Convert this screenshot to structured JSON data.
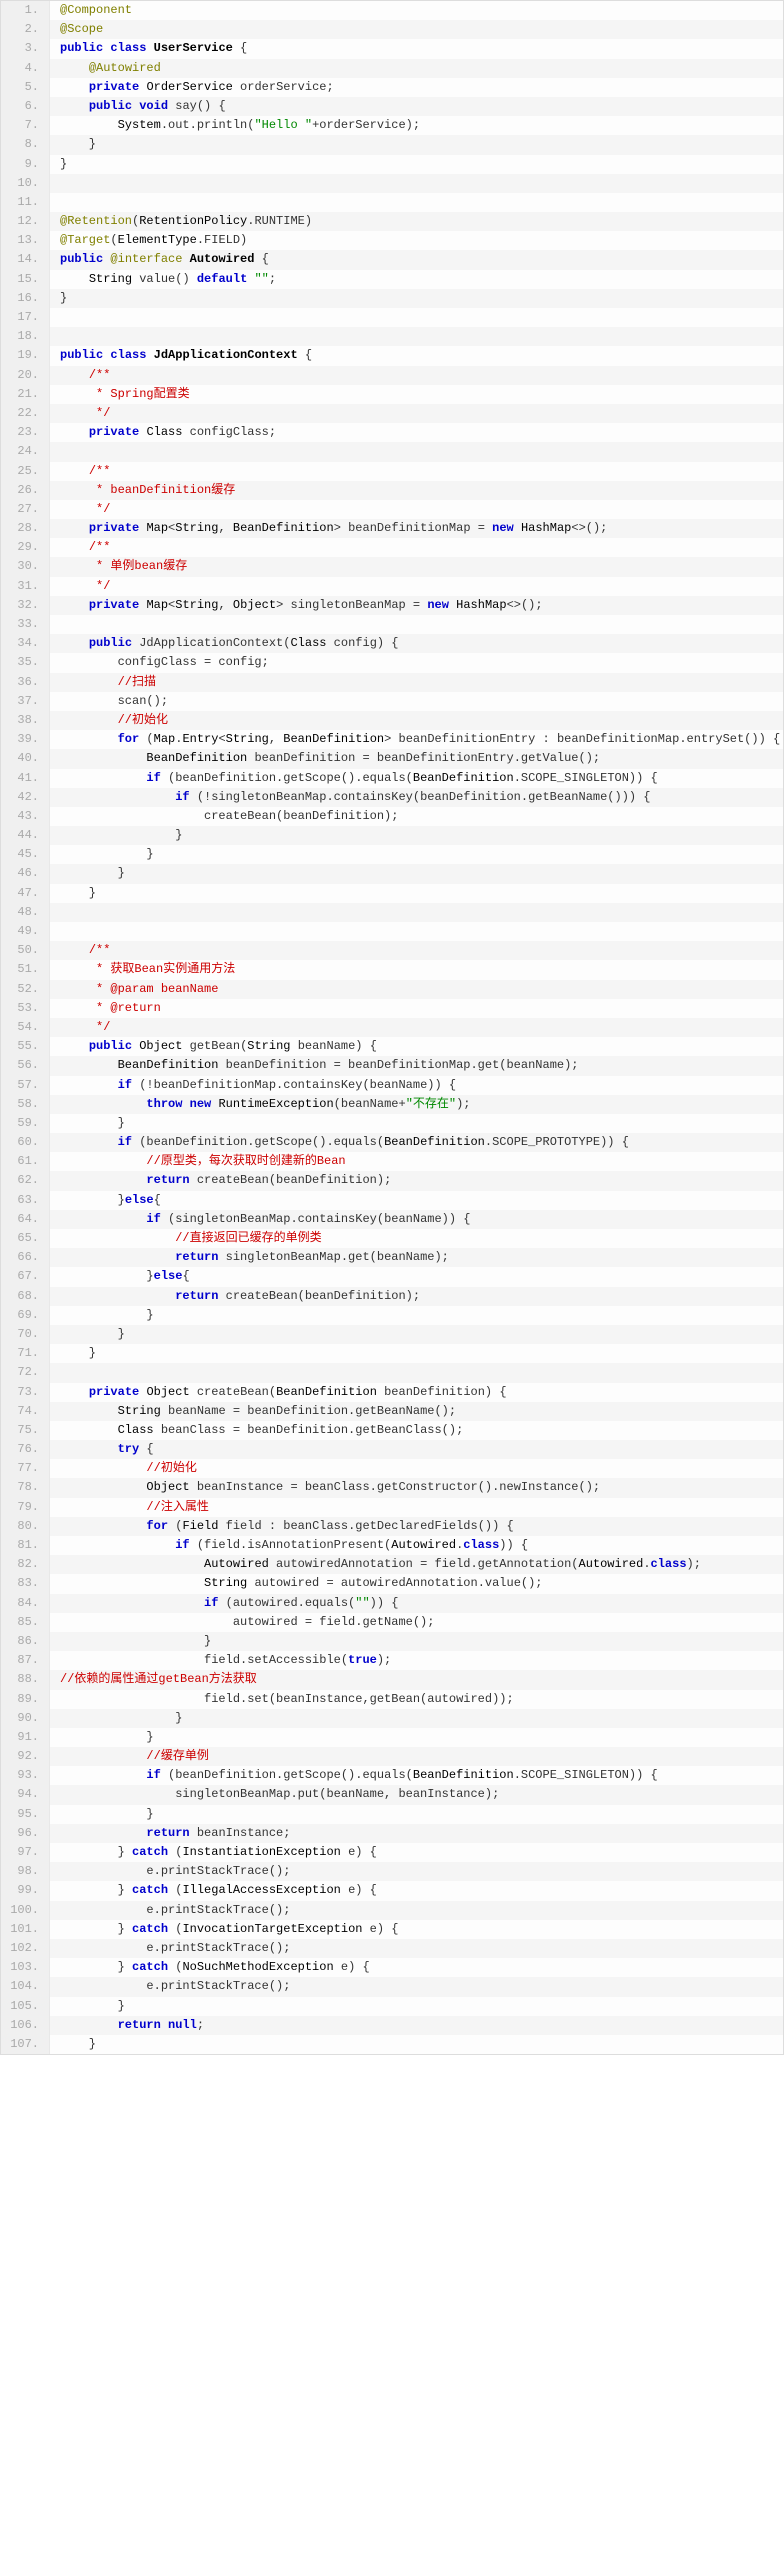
{
  "lines": [
    {
      "n": 1,
      "h": "<span class='an'>@Component</span>"
    },
    {
      "n": 2,
      "h": "<span class='an'>@Scope</span>"
    },
    {
      "n": 3,
      "h": "<span class='kw'>public</span> <span class='kw'>class</span> <span class='cl'>UserService</span> {"
    },
    {
      "n": 4,
      "h": "    <span class='an'>@Autowired</span>"
    },
    {
      "n": 5,
      "h": "    <span class='kw'>private</span> <span class='ty'>OrderService</span> orderService;"
    },
    {
      "n": 6,
      "h": "    <span class='kw'>public</span> <span class='kw'>void</span> <span class='fn'>say</span>() {"
    },
    {
      "n": 7,
      "h": "        <span class='ty'>System</span>.out.println(<span class='st'>\"Hello \"</span>+orderService);"
    },
    {
      "n": 8,
      "h": "    }"
    },
    {
      "n": 9,
      "h": "}"
    },
    {
      "n": 10,
      "h": ""
    },
    {
      "n": 11,
      "h": ""
    },
    {
      "n": 12,
      "h": "<span class='an'>@Retention</span>(<span class='ty'>RetentionPolicy</span>.RUNTIME)"
    },
    {
      "n": 13,
      "h": "<span class='an'>@Target</span>(<span class='ty'>ElementType</span>.FIELD)"
    },
    {
      "n": 14,
      "h": "<span class='kw'>public</span> <span class='an'>@interface</span> <span class='cl'>Autowired</span> {"
    },
    {
      "n": 15,
      "h": "    <span class='ty'>String</span> <span class='fn'>value</span>() <span class='kw'>default</span> <span class='st'>\"\"</span>;"
    },
    {
      "n": 16,
      "h": "}"
    },
    {
      "n": 17,
      "h": ""
    },
    {
      "n": 18,
      "h": ""
    },
    {
      "n": 19,
      "h": "<span class='kw'>public</span> <span class='kw'>class</span> <span class='cl'>JdApplicationContext</span> {"
    },
    {
      "n": 20,
      "h": "    <span class='cm'>/**</span>"
    },
    {
      "n": 21,
      "h": "<span class='cm'>     * Spring配置类</span>"
    },
    {
      "n": 22,
      "h": "<span class='cm'>     */</span>"
    },
    {
      "n": 23,
      "h": "    <span class='kw'>private</span> <span class='ty'>Class</span> configClass;"
    },
    {
      "n": 24,
      "h": ""
    },
    {
      "n": 25,
      "h": "    <span class='cm'>/**</span>"
    },
    {
      "n": 26,
      "h": "<span class='cm'>     * beanDefinition缓存</span>"
    },
    {
      "n": 27,
      "h": "<span class='cm'>     */</span>"
    },
    {
      "n": 28,
      "h": "    <span class='kw'>private</span> <span class='ty'>Map</span>&lt;<span class='ty'>String</span>, <span class='ty'>BeanDefinition</span>&gt; beanDefinitionMap = <span class='kw'>new</span> <span class='ty'>HashMap</span>&lt;&gt;();"
    },
    {
      "n": 29,
      "h": "    <span class='cm'>/**</span>"
    },
    {
      "n": 30,
      "h": "<span class='cm'>     * 单例bean缓存</span>"
    },
    {
      "n": 31,
      "h": "<span class='cm'>     */</span>"
    },
    {
      "n": 32,
      "h": "    <span class='kw'>private</span> <span class='ty'>Map</span>&lt;<span class='ty'>String</span>, <span class='ty'>Object</span>&gt; singletonBeanMap = <span class='kw'>new</span> <span class='ty'>HashMap</span>&lt;&gt;();"
    },
    {
      "n": 33,
      "h": ""
    },
    {
      "n": 34,
      "h": "    <span class='kw'>public</span> <span class='fn'>JdApplicationContext</span>(<span class='ty'>Class</span> config) {"
    },
    {
      "n": 35,
      "h": "        configClass = config;"
    },
    {
      "n": 36,
      "h": "        <span class='cm'>//扫描</span>"
    },
    {
      "n": 37,
      "h": "        scan();"
    },
    {
      "n": 38,
      "h": "        <span class='cm'>//初始化</span>"
    },
    {
      "n": 39,
      "h": "        <span class='kw'>for</span> (<span class='ty'>Map</span>.<span class='ty'>Entry</span>&lt;<span class='ty'>String</span>, <span class='ty'>BeanDefinition</span>&gt; beanDefinitionEntry : beanDefinitionMap.entrySet()) {"
    },
    {
      "n": 40,
      "h": "            <span class='ty'>BeanDefinition</span> beanDefinition = beanDefinitionEntry.getValue();"
    },
    {
      "n": 41,
      "h": "            <span class='kw'>if</span> (beanDefinition.getScope().equals(<span class='ty'>BeanDefinition</span>.SCOPE_SINGLETON)) {"
    },
    {
      "n": 42,
      "h": "                <span class='kw'>if</span> (!singletonBeanMap.containsKey(beanDefinition.getBeanName())) {"
    },
    {
      "n": 43,
      "h": "                    createBean(beanDefinition);"
    },
    {
      "n": 44,
      "h": "                }"
    },
    {
      "n": 45,
      "h": "            }"
    },
    {
      "n": 46,
      "h": "        }"
    },
    {
      "n": 47,
      "h": "    }"
    },
    {
      "n": 48,
      "h": ""
    },
    {
      "n": 49,
      "h": ""
    },
    {
      "n": 50,
      "h": "    <span class='cm'>/**</span>"
    },
    {
      "n": 51,
      "h": "<span class='cm'>     * 获取Bean实例通用方法</span>"
    },
    {
      "n": 52,
      "h": "<span class='cm'>     * @param beanName</span>"
    },
    {
      "n": 53,
      "h": "<span class='cm'>     * @return</span>"
    },
    {
      "n": 54,
      "h": "<span class='cm'>     */</span>"
    },
    {
      "n": 55,
      "h": "    <span class='kw'>public</span> <span class='ty'>Object</span> <span class='fn'>getBean</span>(<span class='ty'>String</span> beanName) {"
    },
    {
      "n": 56,
      "h": "        <span class='ty'>BeanDefinition</span> beanDefinition = beanDefinitionMap.get(beanName);"
    },
    {
      "n": 57,
      "h": "        <span class='kw'>if</span> (!beanDefinitionMap.containsKey(beanName)) {"
    },
    {
      "n": 58,
      "h": "            <span class='kw'>throw</span> <span class='kw'>new</span> <span class='ty'>RuntimeException</span>(beanName+<span class='st'>\"不存在\"</span>);"
    },
    {
      "n": 59,
      "h": "        }"
    },
    {
      "n": 60,
      "h": "        <span class='kw'>if</span> (beanDefinition.getScope().equals(<span class='ty'>BeanDefinition</span>.SCOPE_PROTOTYPE)) {"
    },
    {
      "n": 61,
      "h": "            <span class='cm'>//原型类，每次获取时创建新的Bean</span>"
    },
    {
      "n": 62,
      "h": "            <span class='kw'>return</span> createBean(beanDefinition);"
    },
    {
      "n": 63,
      "h": "        }<span class='kw'>else</span>{"
    },
    {
      "n": 64,
      "h": "            <span class='kw'>if</span> (singletonBeanMap.containsKey(beanName)) {"
    },
    {
      "n": 65,
      "h": "                <span class='cm'>//直接返回已缓存的单例类</span>"
    },
    {
      "n": 66,
      "h": "                <span class='kw'>return</span> singletonBeanMap.get(beanName);"
    },
    {
      "n": 67,
      "h": "            }<span class='kw'>else</span>{"
    },
    {
      "n": 68,
      "h": "                <span class='kw'>return</span> createBean(beanDefinition);"
    },
    {
      "n": 69,
      "h": "            }"
    },
    {
      "n": 70,
      "h": "        }"
    },
    {
      "n": 71,
      "h": "    }"
    },
    {
      "n": 72,
      "h": ""
    },
    {
      "n": 73,
      "h": "    <span class='kw'>private</span> <span class='ty'>Object</span> <span class='fn'>createBean</span>(<span class='ty'>BeanDefinition</span> beanDefinition) {"
    },
    {
      "n": 74,
      "h": "        <span class='ty'>String</span> beanName = beanDefinition.getBeanName();"
    },
    {
      "n": 75,
      "h": "        <span class='ty'>Class</span> beanClass = beanDefinition.getBeanClass();"
    },
    {
      "n": 76,
      "h": "        <span class='kw'>try</span> {"
    },
    {
      "n": 77,
      "h": "            <span class='cm'>//初始化</span>"
    },
    {
      "n": 78,
      "h": "            <span class='ty'>Object</span> beanInstance = beanClass.getConstructor().newInstance();"
    },
    {
      "n": 79,
      "h": "            <span class='cm'>//注入属性</span>"
    },
    {
      "n": 80,
      "h": "            <span class='kw'>for</span> (<span class='ty'>Field</span> field : beanClass.getDeclaredFields()) {"
    },
    {
      "n": 81,
      "h": "                <span class='kw'>if</span> (field.isAnnotationPresent(<span class='ty'>Autowired</span>.<span class='kw'>class</span>)) {"
    },
    {
      "n": 82,
      "h": "                    <span class='ty'>Autowired</span> autowiredAnnotation = field.getAnnotation(<span class='ty'>Autowired</span>.<span class='kw'>class</span>);"
    },
    {
      "n": 83,
      "h": "                    <span class='ty'>String</span> autowired = autowiredAnnotation.value();"
    },
    {
      "n": 84,
      "h": "                    <span class='kw'>if</span> (autowired.equals(<span class='st'>\"\"</span>)) {"
    },
    {
      "n": 85,
      "h": "                        autowired = field.getName();"
    },
    {
      "n": 86,
      "h": "                    }"
    },
    {
      "n": 87,
      "h": "                    field.setAccessible(<span class='kw'>true</span>);"
    },
    {
      "n": 88,
      "h": "<span class='cm'>//依赖的属性通过getBean方法获取</span>"
    },
    {
      "n": 89,
      "h": "                    field.set(beanInstance,getBean(autowired));"
    },
    {
      "n": 90,
      "h": "                }"
    },
    {
      "n": 91,
      "h": "            }"
    },
    {
      "n": 92,
      "h": "            <span class='cm'>//缓存单例</span>"
    },
    {
      "n": 93,
      "h": "            <span class='kw'>if</span> (beanDefinition.getScope().equals(<span class='ty'>BeanDefinition</span>.SCOPE_SINGLETON)) {"
    },
    {
      "n": 94,
      "h": "                singletonBeanMap.put(beanName, beanInstance);"
    },
    {
      "n": 95,
      "h": "            }"
    },
    {
      "n": 96,
      "h": "            <span class='kw'>return</span> beanInstance;"
    },
    {
      "n": 97,
      "h": "        } <span class='kw'>catch</span> (<span class='ty'>InstantiationException</span> e) {"
    },
    {
      "n": 98,
      "h": "            e.printStackTrace();"
    },
    {
      "n": 99,
      "h": "        } <span class='kw'>catch</span> (<span class='ty'>IllegalAccessException</span> e) {"
    },
    {
      "n": 100,
      "h": "            e.printStackTrace();"
    },
    {
      "n": 101,
      "h": "        } <span class='kw'>catch</span> (<span class='ty'>InvocationTargetException</span> e) {"
    },
    {
      "n": 102,
      "h": "            e.printStackTrace();"
    },
    {
      "n": 103,
      "h": "        } <span class='kw'>catch</span> (<span class='ty'>NoSuchMethodException</span> e) {"
    },
    {
      "n": 104,
      "h": "            e.printStackTrace();"
    },
    {
      "n": 105,
      "h": "        }"
    },
    {
      "n": 106,
      "h": "        <span class='kw'>return</span> <span class='kw'>null</span>;"
    },
    {
      "n": 107,
      "h": "    }"
    }
  ]
}
